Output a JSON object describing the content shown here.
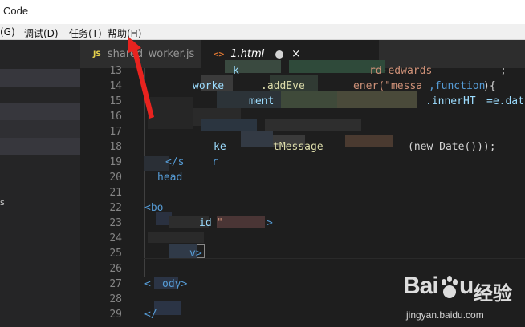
{
  "window": {
    "title": "Code"
  },
  "menu": [
    "(G)",
    "调试(D)",
    "任务(T)",
    "帮助(H)"
  ],
  "sidebar": {
    "fragment": "s"
  },
  "tabs": [
    {
      "icon": "js-file-icon",
      "icon_text": "JS",
      "label": "shared_worker.js",
      "active": false
    },
    {
      "icon": "html-file-icon",
      "icon_text": "<>",
      "label": "1.html",
      "active": true,
      "close": "×"
    }
  ],
  "editor": {
    "line_numbers": [
      "13",
      "14",
      "15",
      "16",
      "17",
      "18",
      "19",
      "20",
      "21",
      "22",
      "23",
      "24",
      "25",
      "26",
      "27",
      "28",
      "29"
    ],
    "lines": {
      "l13_a": "k",
      "l13_b": "rd-edwards",
      "l13_c": ";",
      "l14_a": "worke",
      "l14_b": ".addEve",
      "l14_c": "ener(\"messa",
      "l14_d": ",function",
      "l14_e": "){",
      "l15_a": "ment",
      "l15_b": ".innerHT",
      "l15_c": "=e.dat",
      "l18_a": "ke",
      "l18_b": "tMessage",
      "l18_c": "(new Date()));",
      "l19_a": "</s",
      "l19_b": "r",
      "l20_a": "head",
      "l22_a": "<bo",
      "l23_a": "id",
      "l23_b": "\"",
      "l23_c": ">",
      "l25_a": "v>",
      "l27_a": "<",
      "l27_b": "ody>",
      "l29_a": "</"
    }
  },
  "watermark": {
    "brand": "Bai",
    "brand_end": "u",
    "jingyan": "经验",
    "url": "jingyan.baidu.com"
  },
  "colors": {
    "editor_bg": "#1e1e1e",
    "sidebar_bg": "#252526",
    "tag": "#569cd6",
    "arrow": "#e8231f"
  }
}
